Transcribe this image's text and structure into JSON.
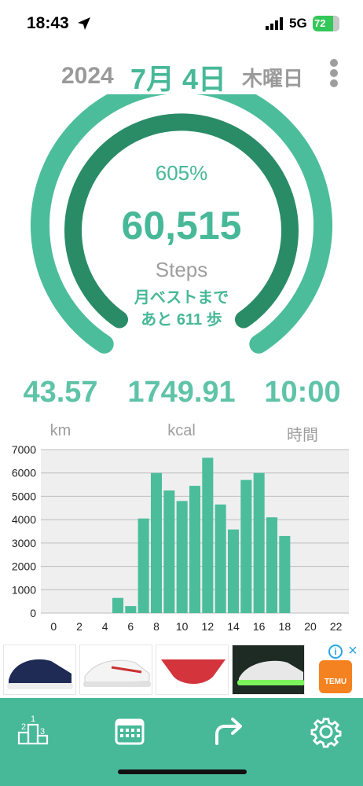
{
  "status_bar": {
    "time": "18:43",
    "network": "5G",
    "battery": "72"
  },
  "header": {
    "year": "2024",
    "month_day": "7月 4日",
    "weekday": "木曜日"
  },
  "gauge": {
    "percent_label": "605%",
    "steps": "60,515",
    "steps_unit": "Steps",
    "best_line1": "月ベストまで",
    "best_line2": "あと 611 歩",
    "outer_fraction": 1.0,
    "inner_fraction": 1.0
  },
  "stats": [
    {
      "value": "43.57",
      "unit": "km"
    },
    {
      "value": "1749.91",
      "unit": "kcal"
    },
    {
      "value": "10:00",
      "unit": "時間"
    }
  ],
  "chart_data": {
    "type": "bar",
    "x": [
      5,
      6,
      7,
      8,
      9,
      10,
      11,
      12,
      13,
      14,
      15,
      16,
      17,
      18
    ],
    "values": [
      650,
      300,
      4050,
      6000,
      5250,
      4800,
      5450,
      6650,
      4650,
      3580,
      5700,
      6000,
      4100,
      3300
    ],
    "xticks": [
      "0",
      "2",
      "4",
      "6",
      "8",
      "10",
      "12",
      "14",
      "16",
      "18",
      "20",
      "22"
    ],
    "yticks": [
      "0",
      "1000",
      "2000",
      "3000",
      "4000",
      "5000",
      "6000",
      "7000"
    ],
    "xlim": [
      -1,
      23
    ],
    "ylim": [
      0,
      7000
    ],
    "grid": true,
    "bar_color": "#4cbd9b"
  },
  "ad": {
    "brand": "TEMU"
  },
  "colors": {
    "accent": "#47b898",
    "dark_accent": "#2a8c66",
    "gray": "#9e9e9e"
  },
  "bottom_nav": [
    {
      "icon": "ranking-icon"
    },
    {
      "icon": "calendar-icon"
    },
    {
      "icon": "share-icon"
    },
    {
      "icon": "settings-icon"
    }
  ]
}
